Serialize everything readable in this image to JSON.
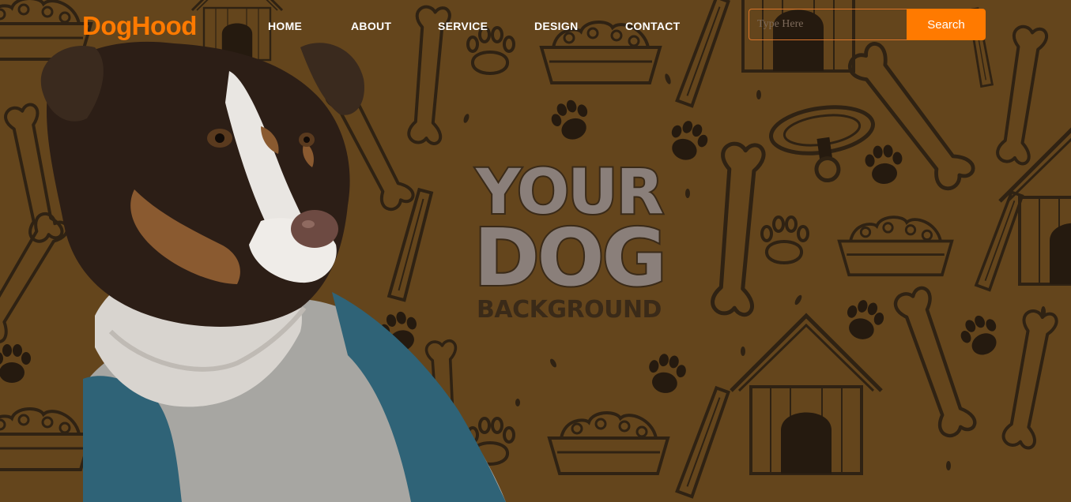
{
  "header": {
    "logo": "DogHood",
    "nav": [
      "HOME",
      "ABOUT",
      "SERVICE",
      "DESIGN",
      "CONTACT"
    ]
  },
  "search": {
    "placeholder": "Type Here",
    "button_label": "Search"
  },
  "hero": {
    "line1": "YOUR",
    "line2": "DOG",
    "line3": "BACKGROUND"
  },
  "colors": {
    "brand": "#ff7a00",
    "background": "#7a5523",
    "ink": "#3a2a18"
  },
  "icons": [
    "bone-icon",
    "paw-icon",
    "dog-bowl-icon",
    "dog-house-icon",
    "dog-collar-icon"
  ]
}
